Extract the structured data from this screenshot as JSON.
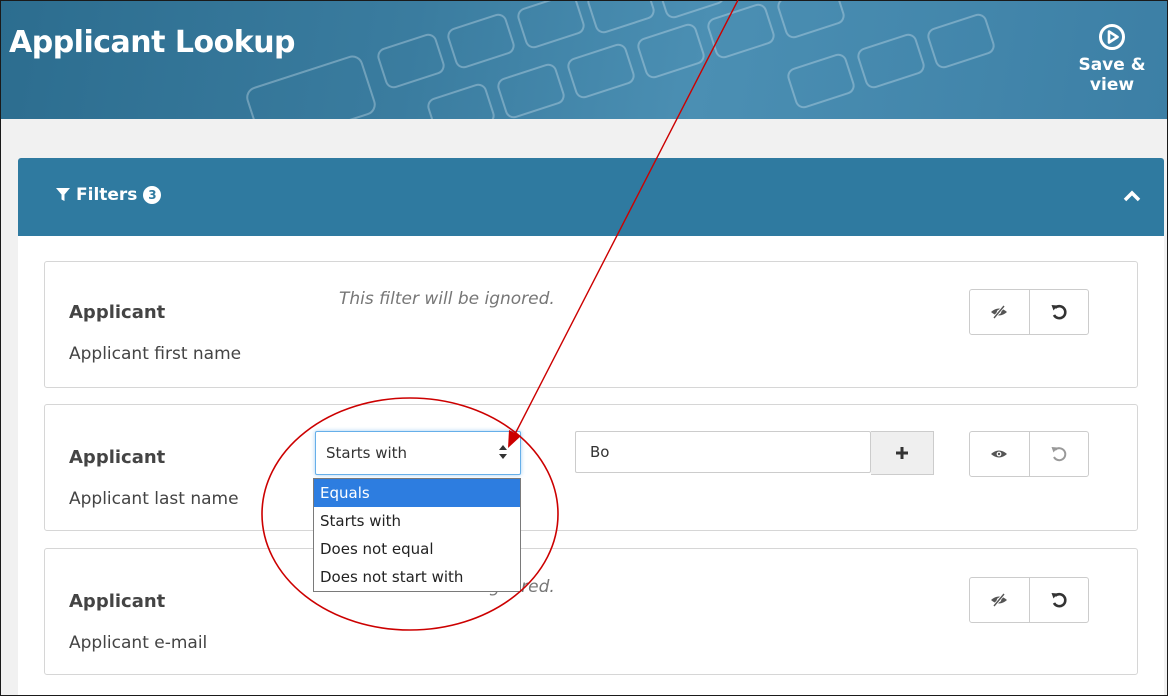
{
  "header": {
    "title": "Applicant Lookup",
    "save_view_label": "Save & view"
  },
  "filters_panel": {
    "title": "Filters",
    "count": "3"
  },
  "filters": [
    {
      "category": "Applicant",
      "field": "Applicant first name",
      "ignored_text": "This filter will be ignored."
    },
    {
      "category": "Applicant",
      "field": "Applicant last name",
      "operator": "Starts with",
      "value": "Bo",
      "operator_options": [
        "Equals",
        "Starts with",
        "Does not equal",
        "Does not start with"
      ],
      "highlighted_option": "Equals"
    },
    {
      "category": "Applicant",
      "field": "Applicant e-mail",
      "ignored_text": "This filter will be ignored."
    }
  ],
  "colors": {
    "header_blue": "#2f7aa0",
    "annotation_red": "#cc0000",
    "dropdown_highlight": "#2d7de0"
  },
  "icons": {
    "filter": "funnel-icon",
    "collapse": "chevron-up-icon",
    "save_view": "play-circle-icon",
    "visibility_off": "eye-slash-icon",
    "visibility_on": "eye-icon",
    "reset": "undo-icon",
    "add": "plus-icon"
  }
}
